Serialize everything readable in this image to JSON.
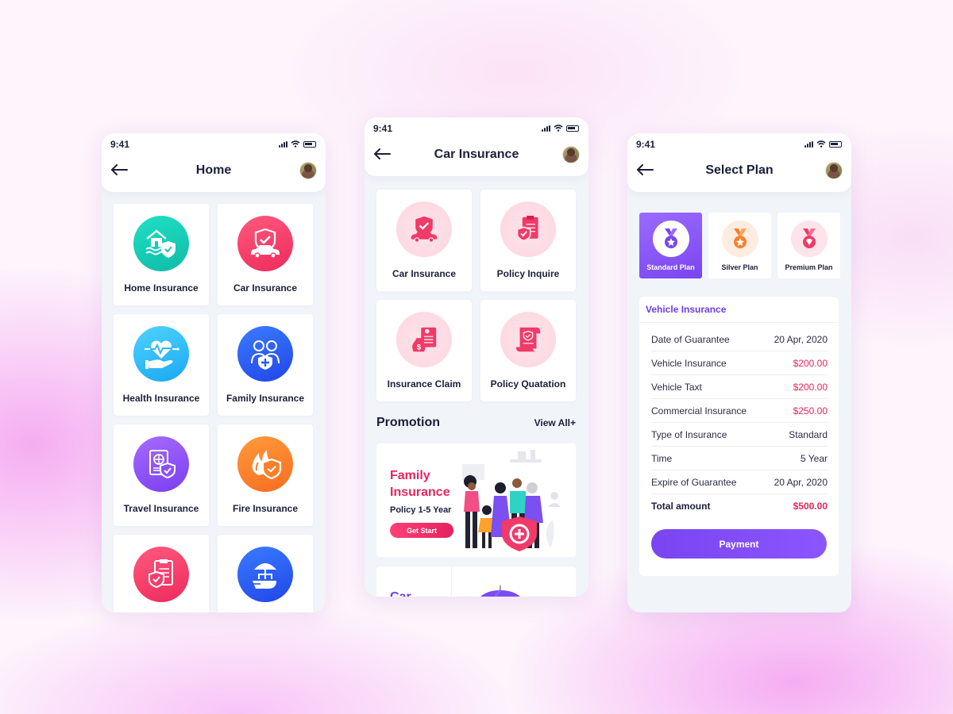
{
  "status_bar": {
    "time": "9:41"
  },
  "screens": {
    "home": {
      "title": "Home",
      "tiles": [
        {
          "label": "Home Insurance",
          "icon": "house-shield-icon",
          "color": "#1fcfb8"
        },
        {
          "label": "Car Insurance",
          "icon": "car-shield-icon",
          "color": "#f23d6a"
        },
        {
          "label": "Health Insurance",
          "icon": "heart-hand-icon",
          "color": "#2fbaf7"
        },
        {
          "label": "Family Insurance",
          "icon": "family-shield-icon",
          "color": "#2b5cf0"
        },
        {
          "label": "Travel Insurance",
          "icon": "passport-shield-icon",
          "color": "#8a52f5"
        },
        {
          "label": "Fire Insurance",
          "icon": "fire-shield-icon",
          "color": "#f7822b"
        },
        {
          "label": "",
          "icon": "document-shield-icon",
          "color": "#f23d6a"
        },
        {
          "label": "",
          "icon": "umbrella-boat-icon",
          "color": "#2b5cf0"
        }
      ]
    },
    "car": {
      "title": "Car Insurance",
      "tiles": [
        {
          "label": "Car Insurance",
          "icon": "car-shield-icon"
        },
        {
          "label": "Policy Inquire",
          "icon": "clipboard-shield-icon"
        },
        {
          "label": "Insurance Claim",
          "icon": "money-bag-document-icon"
        },
        {
          "label": "Policy Quatation",
          "icon": "scroll-shield-icon"
        }
      ],
      "promotion": {
        "heading": "Promotion",
        "view_all": "View All+",
        "card": {
          "title": "Family Insurance",
          "subtitle": "Policy 1-5 Year",
          "button": "Get Start"
        },
        "card2_title": "Car"
      }
    },
    "plan": {
      "title": "Select Plan",
      "plans": [
        {
          "label": "Standard Plan",
          "active": true,
          "icon": "medal-star-icon"
        },
        {
          "label": "Silver Plan",
          "active": false,
          "icon": "medal-star-icon"
        },
        {
          "label": "Premium Plan",
          "active": false,
          "icon": "medal-diamond-icon"
        }
      ],
      "details": {
        "heading": "Vehicle Insurance",
        "rows": [
          {
            "label": "Date of Guarantee",
            "value": "20 Apr, 2020",
            "highlight": false
          },
          {
            "label": "Vehicle Insurance",
            "value": "$200.00",
            "highlight": true
          },
          {
            "label": "Vehicle Taxt",
            "value": "$200.00",
            "highlight": true
          },
          {
            "label": "Commercial Insurance",
            "value": "$250.00",
            "highlight": true
          },
          {
            "label": "Type of Insurance",
            "value": "Standard",
            "highlight": false
          },
          {
            "label": "Time",
            "value": "5 Year",
            "highlight": false
          },
          {
            "label": "Expire of Guarantee",
            "value": "20 Apr, 2020",
            "highlight": false
          }
        ],
        "total": {
          "label": "Total amount",
          "value": "$500.00"
        },
        "button": "Payment"
      }
    }
  },
  "colors": {
    "accent_purple": "#7a45f0",
    "accent_red": "#e8265e",
    "text_dark": "#1c1f3a"
  }
}
